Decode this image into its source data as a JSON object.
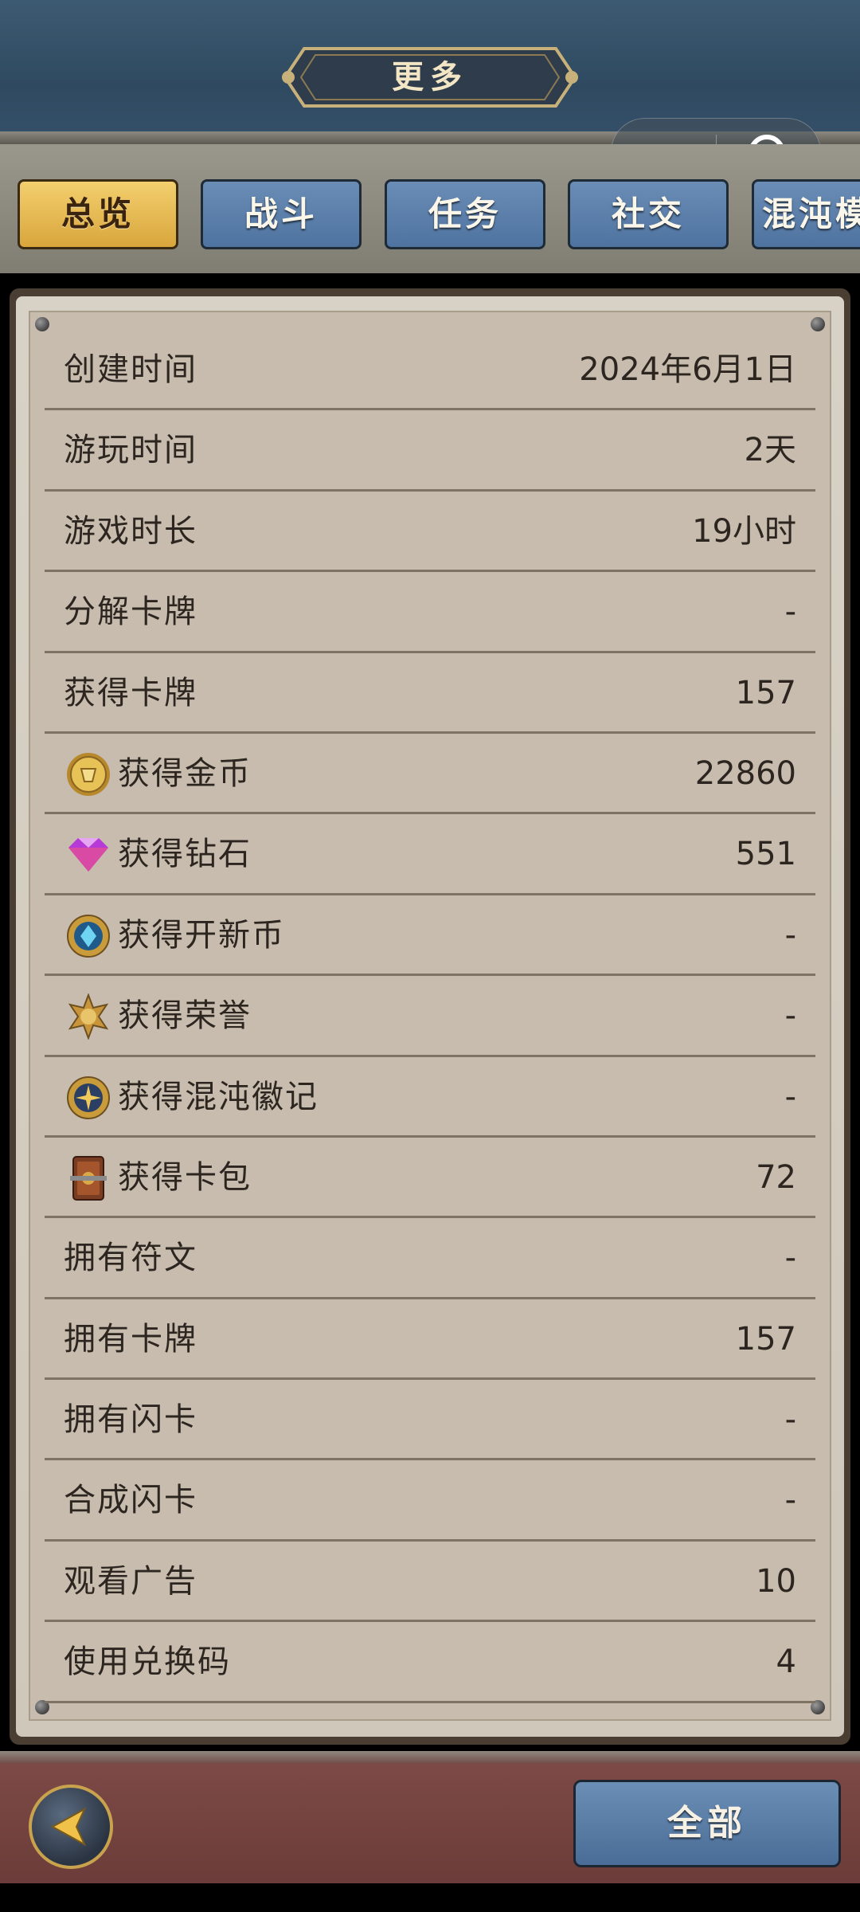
{
  "header": {
    "title": "更多"
  },
  "tabs": [
    {
      "label": "总览",
      "active": true
    },
    {
      "label": "战斗",
      "active": false
    },
    {
      "label": "任务",
      "active": false
    },
    {
      "label": "社交",
      "active": false
    },
    {
      "label": "混沌模",
      "active": false
    }
  ],
  "stats": [
    {
      "label": "创建时间",
      "value": "2024年6月1日",
      "icon": ""
    },
    {
      "label": "游玩时间",
      "value": "2天",
      "icon": ""
    },
    {
      "label": "游戏时长",
      "value": "19小时",
      "icon": ""
    },
    {
      "label": "分解卡牌",
      "value": "-",
      "icon": ""
    },
    {
      "label": "获得卡牌",
      "value": "157",
      "icon": ""
    },
    {
      "label": "获得金币",
      "value": "22860",
      "icon": "gold-coin-icon"
    },
    {
      "label": "获得钻石",
      "value": "551",
      "icon": "diamond-icon"
    },
    {
      "label": "获得开新币",
      "value": "-",
      "icon": "new-coin-icon"
    },
    {
      "label": "获得荣誉",
      "value": "-",
      "icon": "honor-icon"
    },
    {
      "label": "获得混沌徽记",
      "value": "-",
      "icon": "chaos-emblem-icon"
    },
    {
      "label": "获得卡包",
      "value": "72",
      "icon": "card-pack-icon"
    },
    {
      "label": "拥有符文",
      "value": "-",
      "icon": ""
    },
    {
      "label": "拥有卡牌",
      "value": "157",
      "icon": ""
    },
    {
      "label": "拥有闪卡",
      "value": "-",
      "icon": ""
    },
    {
      "label": "合成闪卡",
      "value": "-",
      "icon": ""
    },
    {
      "label": "观看广告",
      "value": "10",
      "icon": ""
    },
    {
      "label": "使用兑换码",
      "value": "4",
      "icon": ""
    }
  ],
  "footer": {
    "all_label": "全部"
  },
  "colors": {
    "tab_active": "#e3b44f",
    "tab_inactive": "#5b80ad",
    "footer_bg": "#74433f"
  }
}
